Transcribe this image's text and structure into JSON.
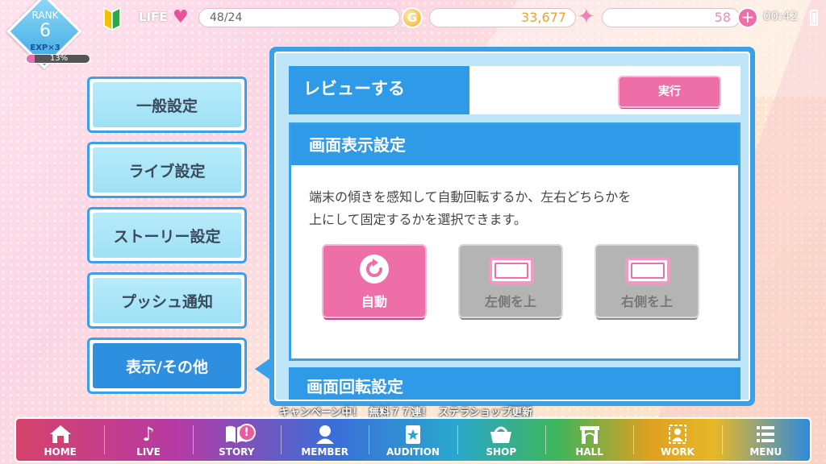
{
  "header": {
    "rank_label": "RANK",
    "rank_value": "6",
    "exp_label": "EXP×3",
    "exp_percent": "13%",
    "exp_fraction": 0.13,
    "life_label": "LIFE",
    "life_value": "48/24",
    "coin_icon_letter": "G",
    "coins": "33,677",
    "stars": "58",
    "plus_symbol": "+",
    "clock": "00:42"
  },
  "sidebar": {
    "items": [
      {
        "label": "一般設定",
        "active": false
      },
      {
        "label": "ライブ設定",
        "active": false
      },
      {
        "label": "ストーリー設定",
        "active": false
      },
      {
        "label": "プッシュ通知",
        "active": false
      },
      {
        "label": "表示/その他",
        "active": true
      }
    ]
  },
  "main": {
    "review_label": "レビューする",
    "run_button": "実行",
    "display_header": "画面表示設定",
    "display_desc_line1": "端末の傾きを感知して自動回転するか、左右どちらかを",
    "display_desc_line2": "上にして固定するかを選択できます。",
    "orientation_options": [
      {
        "label": "自動",
        "selected": true
      },
      {
        "label": "左側を上",
        "selected": false
      },
      {
        "label": "右側を上",
        "selected": false
      }
    ],
    "next_header": "画面回転設定"
  },
  "campaign": {
    "part1": "キャンペーン中！",
    "part2": "無料７７連！",
    "part3": "ステラショップ更新"
  },
  "bottom_nav": {
    "story_badge": "!",
    "items": [
      {
        "label": "HOME",
        "icon": "home-icon"
      },
      {
        "label": "LIVE",
        "icon": "music-note-icon"
      },
      {
        "label": "STORY",
        "icon": "book-icon"
      },
      {
        "label": "MEMBER",
        "icon": "member-icon"
      },
      {
        "label": "AUDITION",
        "icon": "audition-card-icon"
      },
      {
        "label": "SHOP",
        "icon": "basket-icon"
      },
      {
        "label": "HALL",
        "icon": "hall-gate-icon"
      },
      {
        "label": "WORK",
        "icon": "work-icon"
      },
      {
        "label": "MENU",
        "icon": "menu-list-icon"
      }
    ]
  },
  "colors": {
    "accent_blue": "#2e9ae8",
    "accent_pink": "#ee6ea8"
  }
}
